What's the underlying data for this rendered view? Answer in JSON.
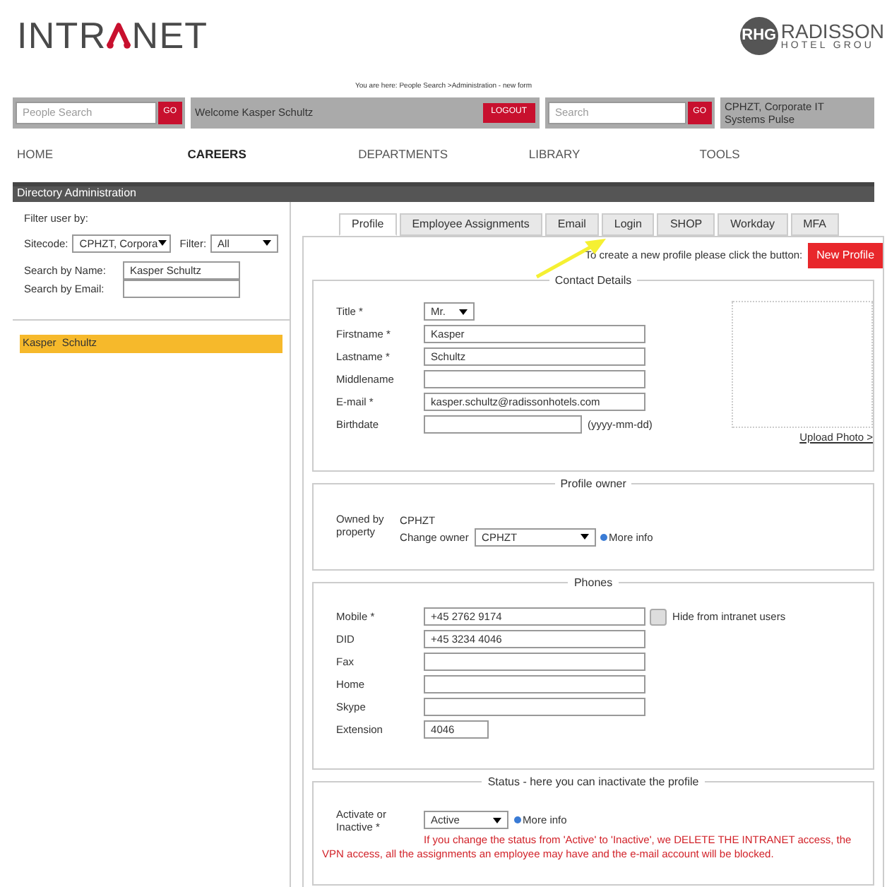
{
  "logo": {
    "left": "INTR",
    "right": "NET"
  },
  "brand": {
    "badge": "RHG",
    "name": "RADISSON",
    "sub": "HOTEL GROU"
  },
  "breadcrumb": "You are here: People Search >Administration - new form",
  "people_search": {
    "placeholder": "People Search",
    "button": "GO"
  },
  "welcome": {
    "text": "Welcome Kasper Schultz",
    "button": "LOGOUT"
  },
  "search": {
    "placeholder": "Search",
    "button": "GO"
  },
  "unit": "CPHZT, Corporate IT Systems Pulse",
  "nav": [
    {
      "label": "HOME",
      "selected": false
    },
    {
      "label": "CAREERS",
      "selected": true
    },
    {
      "label": "DEPARTMENTS",
      "selected": false
    },
    {
      "label": "LIBRARY",
      "selected": false
    },
    {
      "label": "TOOLS",
      "selected": false
    }
  ],
  "panel_title": "Directory Administration",
  "filter": {
    "heading": "Filter user by:",
    "sitecode_label": "Sitecode:",
    "sitecode": "CPHZT, Corpora",
    "filter_label": "Filter:",
    "filter": "All",
    "name_label": "Search by Name:",
    "name": "Kasper Schultz",
    "email_label": "Search by Email:"
  },
  "results": [
    {
      "name": "Kasper  Schultz",
      "selected": true
    }
  ],
  "tabs": [
    {
      "label": "Profile",
      "selected": true
    },
    {
      "label": "Employee Assignments",
      "selected": false
    },
    {
      "label": "Email",
      "selected": false
    },
    {
      "label": "Login",
      "selected": false
    },
    {
      "label": "SHOP",
      "selected": false
    },
    {
      "label": "Workday",
      "selected": false
    },
    {
      "label": "MFA",
      "selected": false
    }
  ],
  "new_profile": {
    "text": "To create a new profile please click the button:",
    "button": "New Profile"
  },
  "contact": {
    "title": "Contact Details",
    "fields": [
      {
        "kind": "select",
        "label": "Title *",
        "value": "Mr."
      },
      {
        "kind": "input",
        "label": "Firstname *",
        "value": "Kasper"
      },
      {
        "kind": "input",
        "label": "Lastname *",
        "value": "Schultz"
      },
      {
        "kind": "input",
        "label": "Middlename"
      },
      {
        "kind": "input",
        "label": "E-mail *",
        "value": "kasper.schultz@radissonhotels.com"
      },
      {
        "kind": "date",
        "label": "Birthdate",
        "hint": "(yyyy-mm-dd)"
      }
    ],
    "upload": "Upload Photo >"
  },
  "owner": {
    "title": "Profile owner",
    "label": "Owned by property",
    "value": "CPHZT",
    "change_label": "Change owner",
    "select": "CPHZT",
    "info": "More info"
  },
  "phones": {
    "title": "Phones",
    "fields": [
      {
        "kind": "input",
        "label": "Mobile *",
        "value": "+45 2762 9174",
        "checkbox": {
          "label": "Hide from intranet users",
          "checked": false
        }
      },
      {
        "kind": "input",
        "label": "DID",
        "value": "+45 3234 4046"
      },
      {
        "kind": "input",
        "label": "Fax"
      },
      {
        "kind": "input",
        "label": "Home"
      },
      {
        "kind": "input",
        "label": "Skype"
      },
      {
        "kind": "short",
        "label": "Extension",
        "value": "4046"
      }
    ]
  },
  "status": {
    "title": "Status - here you can inactivate the profile",
    "label": "Activate or Inactive *",
    "select": "Active",
    "info": "More info",
    "warning": "If you change the status from 'Active' to 'Inactive', we DELETE THE INTRANET access, the VPN access, all the assignments an employee may have and the e-mail account will be blocked."
  }
}
